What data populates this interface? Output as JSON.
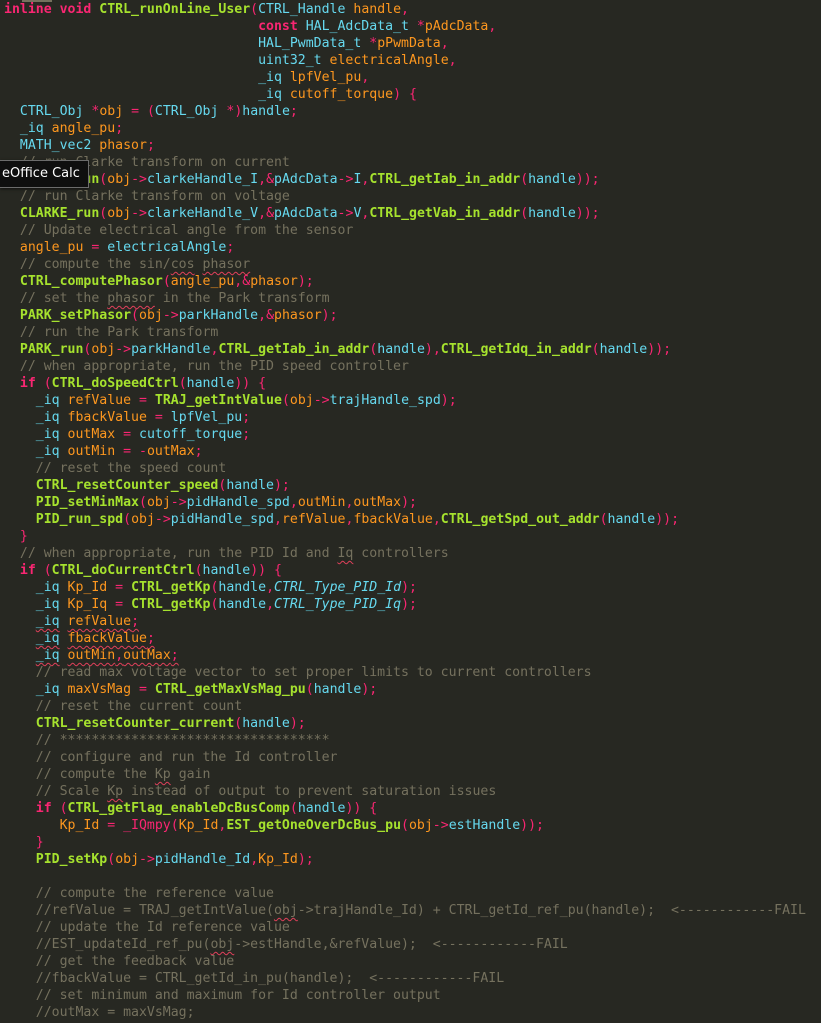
{
  "tooltip": {
    "text": "eOffice Calc"
  },
  "palette": {
    "bg": "#272822",
    "keyword": "#f92672",
    "function": "#a6e22e",
    "type": "#66d9ef",
    "param": "#fd971f",
    "comment": "#75715e",
    "text": "#f8f8f2"
  },
  "code_lines": [
    [
      [
        "kw",
        "inline void "
      ],
      [
        "fn",
        "CTRL_runOnLine_User"
      ],
      [
        "op",
        "("
      ],
      [
        "type",
        "CTRL_Handle"
      ],
      [
        "prm",
        " handle"
      ],
      [
        "op",
        ","
      ]
    ],
    [
      [
        "op",
        "                                "
      ],
      [
        "kw",
        "const "
      ],
      [
        "type",
        "HAL_AdcData_t "
      ],
      [
        "op",
        "*"
      ],
      [
        "prm",
        "pAdcData"
      ],
      [
        "op",
        ","
      ]
    ],
    [
      [
        "op",
        "                                "
      ],
      [
        "type",
        "HAL_PwmData_t "
      ],
      [
        "op",
        "*"
      ],
      [
        "prm",
        "pPwmData"
      ],
      [
        "op",
        ","
      ]
    ],
    [
      [
        "op",
        "                                "
      ],
      [
        "type",
        "uint32_t"
      ],
      [
        "prm",
        " electricalAngle"
      ],
      [
        "op",
        ","
      ]
    ],
    [
      [
        "op",
        "                                "
      ],
      [
        "type",
        "_iq"
      ],
      [
        "prm",
        " lpfVel_pu"
      ],
      [
        "op",
        ","
      ]
    ],
    [
      [
        "op",
        "                                "
      ],
      [
        "type",
        "_iq"
      ],
      [
        "prm",
        " cutoff_torque"
      ],
      [
        "op",
        ") {"
      ]
    ],
    [
      [
        "op",
        "  "
      ],
      [
        "type",
        "CTRL_Obj "
      ],
      [
        "op",
        "*"
      ],
      [
        "prm",
        "obj"
      ],
      [
        "op",
        " = ("
      ],
      [
        "type",
        "CTRL_Obj "
      ],
      [
        "op",
        "*)"
      ],
      [
        "type",
        "handle"
      ],
      [
        "op",
        ";"
      ]
    ],
    [
      [
        "op",
        "  "
      ],
      [
        "type",
        "_iq"
      ],
      [
        "prm",
        " angle_pu"
      ],
      [
        "op",
        ";"
      ]
    ],
    [
      [
        "op",
        "  "
      ],
      [
        "type",
        "MATH_vec2"
      ],
      [
        "prm",
        " phasor"
      ],
      [
        "op",
        ";"
      ]
    ],
    [
      [
        "cmt",
        "  // run Clarke transform on current"
      ]
    ],
    [
      [
        "op",
        "  "
      ],
      [
        "fn",
        "CLARKE_run"
      ],
      [
        "op",
        "("
      ],
      [
        "prm",
        "obj"
      ],
      [
        "op",
        "->"
      ],
      [
        "id",
        "clarkeHandle_I"
      ],
      [
        "op",
        ",&"
      ],
      [
        "id",
        "pAdcData"
      ],
      [
        "op",
        "->"
      ],
      [
        "id",
        "I"
      ],
      [
        "op",
        ","
      ],
      [
        "fn",
        "CTRL_getIab_in_addr"
      ],
      [
        "op",
        "("
      ],
      [
        "id",
        "handle"
      ],
      [
        "op",
        "));"
      ]
    ],
    [
      [
        "cmt",
        "  // run Clarke transform on voltage"
      ]
    ],
    [
      [
        "op",
        "  "
      ],
      [
        "fn",
        "CLARKE_run"
      ],
      [
        "op",
        "("
      ],
      [
        "prm",
        "obj"
      ],
      [
        "op",
        "->"
      ],
      [
        "id",
        "clarkeHandle_V"
      ],
      [
        "op",
        ",&"
      ],
      [
        "id",
        "pAdcData"
      ],
      [
        "op",
        "->"
      ],
      [
        "id",
        "V"
      ],
      [
        "op",
        ","
      ],
      [
        "fn",
        "CTRL_getVab_in_addr"
      ],
      [
        "op",
        "("
      ],
      [
        "id",
        "handle"
      ],
      [
        "op",
        "));"
      ]
    ],
    [
      [
        "cmt",
        "  // Update electrical angle from the sensor"
      ]
    ],
    [
      [
        "op",
        "  "
      ],
      [
        "prm",
        "angle_pu"
      ],
      [
        "op",
        " = "
      ],
      [
        "id",
        "electricalAngle"
      ],
      [
        "op",
        ";"
      ]
    ],
    [
      [
        "cmt",
        "  // compute the sin/"
      ],
      [
        "cmtsq",
        "cos"
      ],
      [
        "cmt",
        " "
      ],
      [
        "cmtsq",
        "phasor"
      ]
    ],
    [
      [
        "op",
        "  "
      ],
      [
        "fn",
        "CTRL_computePhasor"
      ],
      [
        "op",
        "("
      ],
      [
        "prm",
        "angle_pu"
      ],
      [
        "op",
        ",&"
      ],
      [
        "prm",
        "phasor"
      ],
      [
        "op",
        ");"
      ]
    ],
    [
      [
        "cmt",
        "  // set the "
      ],
      [
        "cmtsq",
        "phasor"
      ],
      [
        "cmt",
        " in the Park transform"
      ]
    ],
    [
      [
        "op",
        "  "
      ],
      [
        "fn",
        "PARK_setPhasor"
      ],
      [
        "op",
        "("
      ],
      [
        "prm",
        "obj"
      ],
      [
        "op",
        "->"
      ],
      [
        "id",
        "parkHandle"
      ],
      [
        "op",
        ",&"
      ],
      [
        "prm",
        "phasor"
      ],
      [
        "op",
        ");"
      ]
    ],
    [
      [
        "cmt",
        "  // run the Park transform"
      ]
    ],
    [
      [
        "op",
        "  "
      ],
      [
        "fn",
        "PARK_run"
      ],
      [
        "op",
        "("
      ],
      [
        "prm",
        "obj"
      ],
      [
        "op",
        "->"
      ],
      [
        "id",
        "parkHandle"
      ],
      [
        "op",
        ","
      ],
      [
        "fn",
        "CTRL_getIab_in_addr"
      ],
      [
        "op",
        "("
      ],
      [
        "id",
        "handle"
      ],
      [
        "op",
        "),"
      ],
      [
        "fn",
        "CTRL_getIdq_in_addr"
      ],
      [
        "op",
        "("
      ],
      [
        "id",
        "handle"
      ],
      [
        "op",
        "));"
      ]
    ],
    [
      [
        "cmt",
        "  // when appropriate, run the PID speed controller"
      ]
    ],
    [
      [
        "op",
        "  "
      ],
      [
        "kw",
        "if"
      ],
      [
        "op",
        " ("
      ],
      [
        "fn",
        "CTRL_doSpeedCtrl"
      ],
      [
        "op",
        "("
      ],
      [
        "id",
        "handle"
      ],
      [
        "op",
        ")) {"
      ]
    ],
    [
      [
        "op",
        "    "
      ],
      [
        "type",
        "_iq"
      ],
      [
        "prm",
        " refValue"
      ],
      [
        "op",
        " = "
      ],
      [
        "fn",
        "TRAJ_getIntValue"
      ],
      [
        "op",
        "("
      ],
      [
        "prm",
        "obj"
      ],
      [
        "op",
        "->"
      ],
      [
        "id",
        "trajHandle_spd"
      ],
      [
        "op",
        ");"
      ]
    ],
    [
      [
        "op",
        "    "
      ],
      [
        "type",
        "_iq"
      ],
      [
        "prm",
        " fbackValue"
      ],
      [
        "op",
        " = "
      ],
      [
        "id",
        "lpfVel_pu"
      ],
      [
        "op",
        ";"
      ]
    ],
    [
      [
        "op",
        "    "
      ],
      [
        "type",
        "_iq"
      ],
      [
        "prm",
        " outMax"
      ],
      [
        "op",
        " = "
      ],
      [
        "id",
        "cutoff_torque"
      ],
      [
        "op",
        ";"
      ]
    ],
    [
      [
        "op",
        "    "
      ],
      [
        "type",
        "_iq"
      ],
      [
        "prm",
        " outMin"
      ],
      [
        "op",
        " = -"
      ],
      [
        "prm",
        "outMax"
      ],
      [
        "op",
        ";"
      ]
    ],
    [
      [
        "cmt",
        "    // reset the speed count"
      ]
    ],
    [
      [
        "op",
        "    "
      ],
      [
        "fn",
        "CTRL_resetCounter_speed"
      ],
      [
        "op",
        "("
      ],
      [
        "id",
        "handle"
      ],
      [
        "op",
        ");"
      ]
    ],
    [
      [
        "op",
        "    "
      ],
      [
        "fn",
        "PID_setMinMax"
      ],
      [
        "op",
        "("
      ],
      [
        "prm",
        "obj"
      ],
      [
        "op",
        "->"
      ],
      [
        "id",
        "pidHandle_spd"
      ],
      [
        "op",
        ","
      ],
      [
        "prm",
        "outMin"
      ],
      [
        "op",
        ","
      ],
      [
        "prm",
        "outMax"
      ],
      [
        "op",
        ");"
      ]
    ],
    [
      [
        "op",
        "    "
      ],
      [
        "fn",
        "PID_run_spd"
      ],
      [
        "op",
        "("
      ],
      [
        "prm",
        "obj"
      ],
      [
        "op",
        "->"
      ],
      [
        "id",
        "pidHandle_spd"
      ],
      [
        "op",
        ","
      ],
      [
        "prm",
        "refValue"
      ],
      [
        "op",
        ","
      ],
      [
        "prm",
        "fbackValue"
      ],
      [
        "op",
        ","
      ],
      [
        "fn",
        "CTRL_getSpd_out_addr"
      ],
      [
        "op",
        "("
      ],
      [
        "id",
        "handle"
      ],
      [
        "op",
        "));"
      ]
    ],
    [
      [
        "op",
        "  }"
      ]
    ],
    [
      [
        "cmt",
        "  // when appropriate, run the PID Id and "
      ],
      [
        "cmtsq",
        "Iq"
      ],
      [
        "cmt",
        " controllers"
      ]
    ],
    [
      [
        "op",
        "  "
      ],
      [
        "kw",
        "if"
      ],
      [
        "op",
        " ("
      ],
      [
        "fn",
        "CTRL_doCurrentCtrl"
      ],
      [
        "op",
        "("
      ],
      [
        "id",
        "handle"
      ],
      [
        "op",
        ")) {"
      ]
    ],
    [
      [
        "op",
        "    "
      ],
      [
        "type",
        "_iq"
      ],
      [
        "prm",
        " Kp_Id"
      ],
      [
        "op",
        " = "
      ],
      [
        "fn",
        "CTRL_getKp"
      ],
      [
        "op",
        "("
      ],
      [
        "id",
        "handle"
      ],
      [
        "op",
        ","
      ],
      [
        "ital",
        "CTRL_Type_PID_Id"
      ],
      [
        "op",
        ");"
      ]
    ],
    [
      [
        "op",
        "    "
      ],
      [
        "type",
        "_iq"
      ],
      [
        "prm",
        " Kp_Iq"
      ],
      [
        "op",
        " = "
      ],
      [
        "fn",
        "CTRL_getKp"
      ],
      [
        "op",
        "("
      ],
      [
        "id",
        "handle"
      ],
      [
        "op",
        ","
      ],
      [
        "ital",
        "CTRL_Type_PID_Iq"
      ],
      [
        "op",
        ");"
      ]
    ],
    [
      [
        "op",
        "    "
      ],
      [
        "typesq",
        "_iq"
      ],
      [
        "prm",
        " "
      ],
      [
        "prmsq",
        "refValue"
      ],
      [
        "opsq",
        ";"
      ]
    ],
    [
      [
        "op",
        "    "
      ],
      [
        "typesq",
        "_iq"
      ],
      [
        "prm",
        " "
      ],
      [
        "prmsq",
        "fbackValue"
      ],
      [
        "opsq",
        ";"
      ]
    ],
    [
      [
        "op",
        "    "
      ],
      [
        "typesq",
        "_iq"
      ],
      [
        "prm",
        " "
      ],
      [
        "prmsq",
        "outMin"
      ],
      [
        "opsq",
        ","
      ],
      [
        "prmsq",
        "outMax"
      ],
      [
        "opsq",
        ";"
      ]
    ],
    [
      [
        "cmt",
        "    // read max voltage vector to set proper limits to current controllers"
      ]
    ],
    [
      [
        "op",
        "    "
      ],
      [
        "type",
        "_iq"
      ],
      [
        "prm",
        " maxVsMag"
      ],
      [
        "op",
        " = "
      ],
      [
        "fn",
        "CTRL_getMaxVsMag_pu"
      ],
      [
        "op",
        "("
      ],
      [
        "id",
        "handle"
      ],
      [
        "op",
        ");"
      ]
    ],
    [
      [
        "cmt",
        "    // reset the current count"
      ]
    ],
    [
      [
        "op",
        "    "
      ],
      [
        "fn",
        "CTRL_resetCounter_current"
      ],
      [
        "op",
        "("
      ],
      [
        "id",
        "handle"
      ],
      [
        "op",
        ");"
      ]
    ],
    [
      [
        "cmt",
        "    // **********************************"
      ]
    ],
    [
      [
        "cmt",
        "    // configure and run the Id controller"
      ]
    ],
    [
      [
        "cmt",
        "    // compute the "
      ],
      [
        "cmtsq",
        "Kp"
      ],
      [
        "cmt",
        " gain"
      ]
    ],
    [
      [
        "cmt",
        "    // Scale "
      ],
      [
        "cmtsq",
        "Kp"
      ],
      [
        "cmt",
        " instead of output to prevent saturation issues"
      ]
    ],
    [
      [
        "op",
        "    "
      ],
      [
        "kw",
        "if"
      ],
      [
        "op",
        " ("
      ],
      [
        "fn",
        "CTRL_getFlag_enableDcBusComp"
      ],
      [
        "op",
        "("
      ],
      [
        "id",
        "handle"
      ],
      [
        "op",
        ")) {"
      ]
    ],
    [
      [
        "op",
        "       "
      ],
      [
        "prm",
        "Kp_Id"
      ],
      [
        "op",
        " = "
      ],
      [
        "op",
        "_IQmpy("
      ],
      [
        "prm",
        "Kp_Id"
      ],
      [
        "op",
        ","
      ],
      [
        "fn",
        "EST_getOneOverDcBus_pu"
      ],
      [
        "op",
        "("
      ],
      [
        "prm",
        "obj"
      ],
      [
        "op",
        "->"
      ],
      [
        "id",
        "estHandle"
      ],
      [
        "op",
        "));"
      ]
    ],
    [
      [
        "op",
        "    }"
      ]
    ],
    [
      [
        "op",
        "    "
      ],
      [
        "fn",
        "PID_setKp"
      ],
      [
        "op",
        "("
      ],
      [
        "prm",
        "obj"
      ],
      [
        "op",
        "->"
      ],
      [
        "id",
        "pidHandle_Id"
      ],
      [
        "op",
        ","
      ],
      [
        "prm",
        "Kp_Id"
      ],
      [
        "op",
        ");"
      ]
    ],
    [
      [
        "op",
        ""
      ]
    ],
    [
      [
        "cmt",
        "    // compute the reference value"
      ]
    ],
    [
      [
        "cmt",
        "    //refValue = TRAJ_getIntValue("
      ],
      [
        "cmtsq",
        "obj"
      ],
      [
        "cmt",
        "->trajHandle_Id) + CTRL_getId_ref_pu(handle);  <------------FAIL"
      ]
    ],
    [
      [
        "cmt",
        "    // update the Id reference value"
      ]
    ],
    [
      [
        "cmt",
        "    //EST_updateId_ref_pu("
      ],
      [
        "cmtsq",
        "obj"
      ],
      [
        "cmt",
        "->estHandle,&refValue);  <------------FAIL"
      ]
    ],
    [
      [
        "cmt",
        "    // get the feedback value"
      ]
    ],
    [
      [
        "cmt",
        "    //fbackValue = CTRL_getId_in_pu(handle);  <------------FAIL"
      ]
    ],
    [
      [
        "cmt",
        "    // set minimum and maximum for Id controller output"
      ]
    ],
    [
      [
        "cmt",
        "    //outMax = maxVsMag;"
      ]
    ]
  ]
}
